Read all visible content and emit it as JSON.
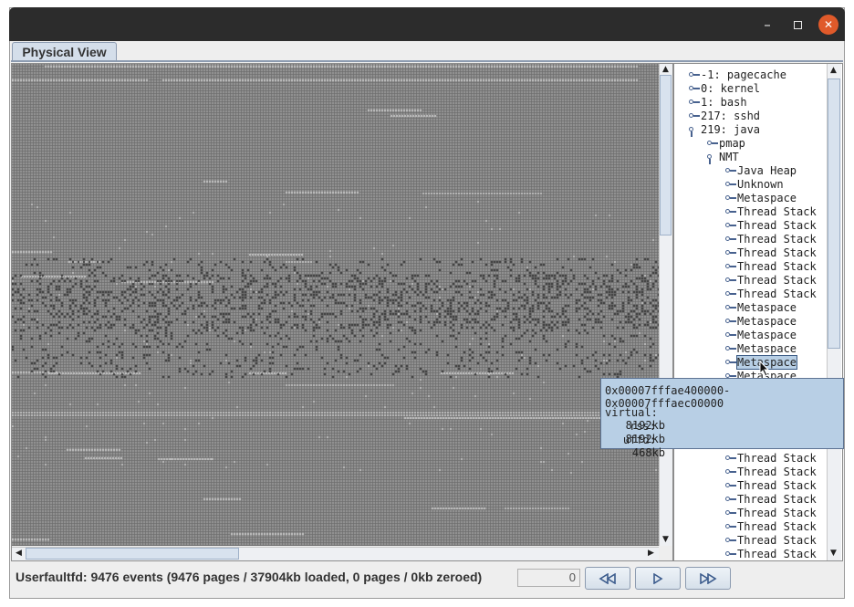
{
  "window": {
    "controls": [
      "minimize",
      "maximize",
      "close"
    ]
  },
  "tab": {
    "label": "Physical View"
  },
  "map": {
    "colors": {
      "background": "#6e6e6e",
      "free": "#9a9a9a",
      "used": "#c8c8c8",
      "hot": "#3a3a3a"
    }
  },
  "tree": {
    "nodes": [
      {
        "label": "-1: pagecache",
        "level": 0,
        "expanded": false
      },
      {
        "label": "0: kernel",
        "level": 0,
        "expanded": false
      },
      {
        "label": "1: bash",
        "level": 0,
        "expanded": false
      },
      {
        "label": "217: sshd",
        "level": 0,
        "expanded": false
      },
      {
        "label": "219: java",
        "level": 0,
        "expanded": true
      },
      {
        "label": "pmap",
        "level": 1,
        "expanded": false
      },
      {
        "label": "NMT",
        "level": 1,
        "expanded": true
      },
      {
        "label": "Java Heap",
        "level": 2,
        "expanded": false
      },
      {
        "label": "Unknown",
        "level": 2,
        "expanded": false
      },
      {
        "label": "Metaspace",
        "level": 2,
        "expanded": false
      },
      {
        "label": "Thread Stack",
        "level": 2,
        "expanded": false
      },
      {
        "label": "Thread Stack",
        "level": 2,
        "expanded": false
      },
      {
        "label": "Thread Stack",
        "level": 2,
        "expanded": false
      },
      {
        "label": "Thread Stack",
        "level": 2,
        "expanded": false
      },
      {
        "label": "Thread Stack",
        "level": 2,
        "expanded": false
      },
      {
        "label": "Thread Stack",
        "level": 2,
        "expanded": false
      },
      {
        "label": "Thread Stack",
        "level": 2,
        "expanded": false
      },
      {
        "label": "Metaspace",
        "level": 2,
        "expanded": false
      },
      {
        "label": "Metaspace",
        "level": 2,
        "expanded": false
      },
      {
        "label": "Metaspace",
        "level": 2,
        "expanded": false
      },
      {
        "label": "Metaspace",
        "level": 2,
        "expanded": false
      },
      {
        "label": "Metaspace",
        "level": 2,
        "expanded": false,
        "selected": true
      },
      {
        "label": "Metaspace",
        "level": 2,
        "expanded": false
      },
      {
        "label": "",
        "level": 2,
        "expanded": false
      },
      {
        "label": "",
        "level": 2,
        "expanded": false
      },
      {
        "label": "",
        "level": 2,
        "expanded": false
      },
      {
        "label": "",
        "level": 2,
        "expanded": false
      },
      {
        "label": "",
        "level": 2,
        "expanded": false
      },
      {
        "label": "Thread Stack",
        "level": 2,
        "expanded": false
      },
      {
        "label": "Thread Stack",
        "level": 2,
        "expanded": false
      },
      {
        "label": "Thread Stack",
        "level": 2,
        "expanded": false
      },
      {
        "label": "Thread Stack",
        "level": 2,
        "expanded": false
      },
      {
        "label": "Thread Stack",
        "level": 2,
        "expanded": false
      },
      {
        "label": "Thread Stack",
        "level": 2,
        "expanded": false
      },
      {
        "label": "Thread Stack",
        "level": 2,
        "expanded": false
      },
      {
        "label": "Thread Stack",
        "level": 2,
        "expanded": false
      }
    ]
  },
  "tooltip": {
    "range": "0x00007fffae400000-0x00007fffaec00000",
    "rows": [
      {
        "key": "virtual:",
        "value": "8192kb"
      },
      {
        "key": "rss:",
        "value": "8192kb"
      },
      {
        "key": "uffd:",
        "value": "468kb"
      }
    ]
  },
  "status": {
    "text": "Userfaultfd: 9476 events (9476 pages / 37904kb loaded, 0 pages / 0kb zeroed)",
    "counter": "0"
  },
  "nav": {
    "rewind_icon": "rewind-icon",
    "play_icon": "play-icon",
    "fast_forward_icon": "fast-forward-icon"
  }
}
